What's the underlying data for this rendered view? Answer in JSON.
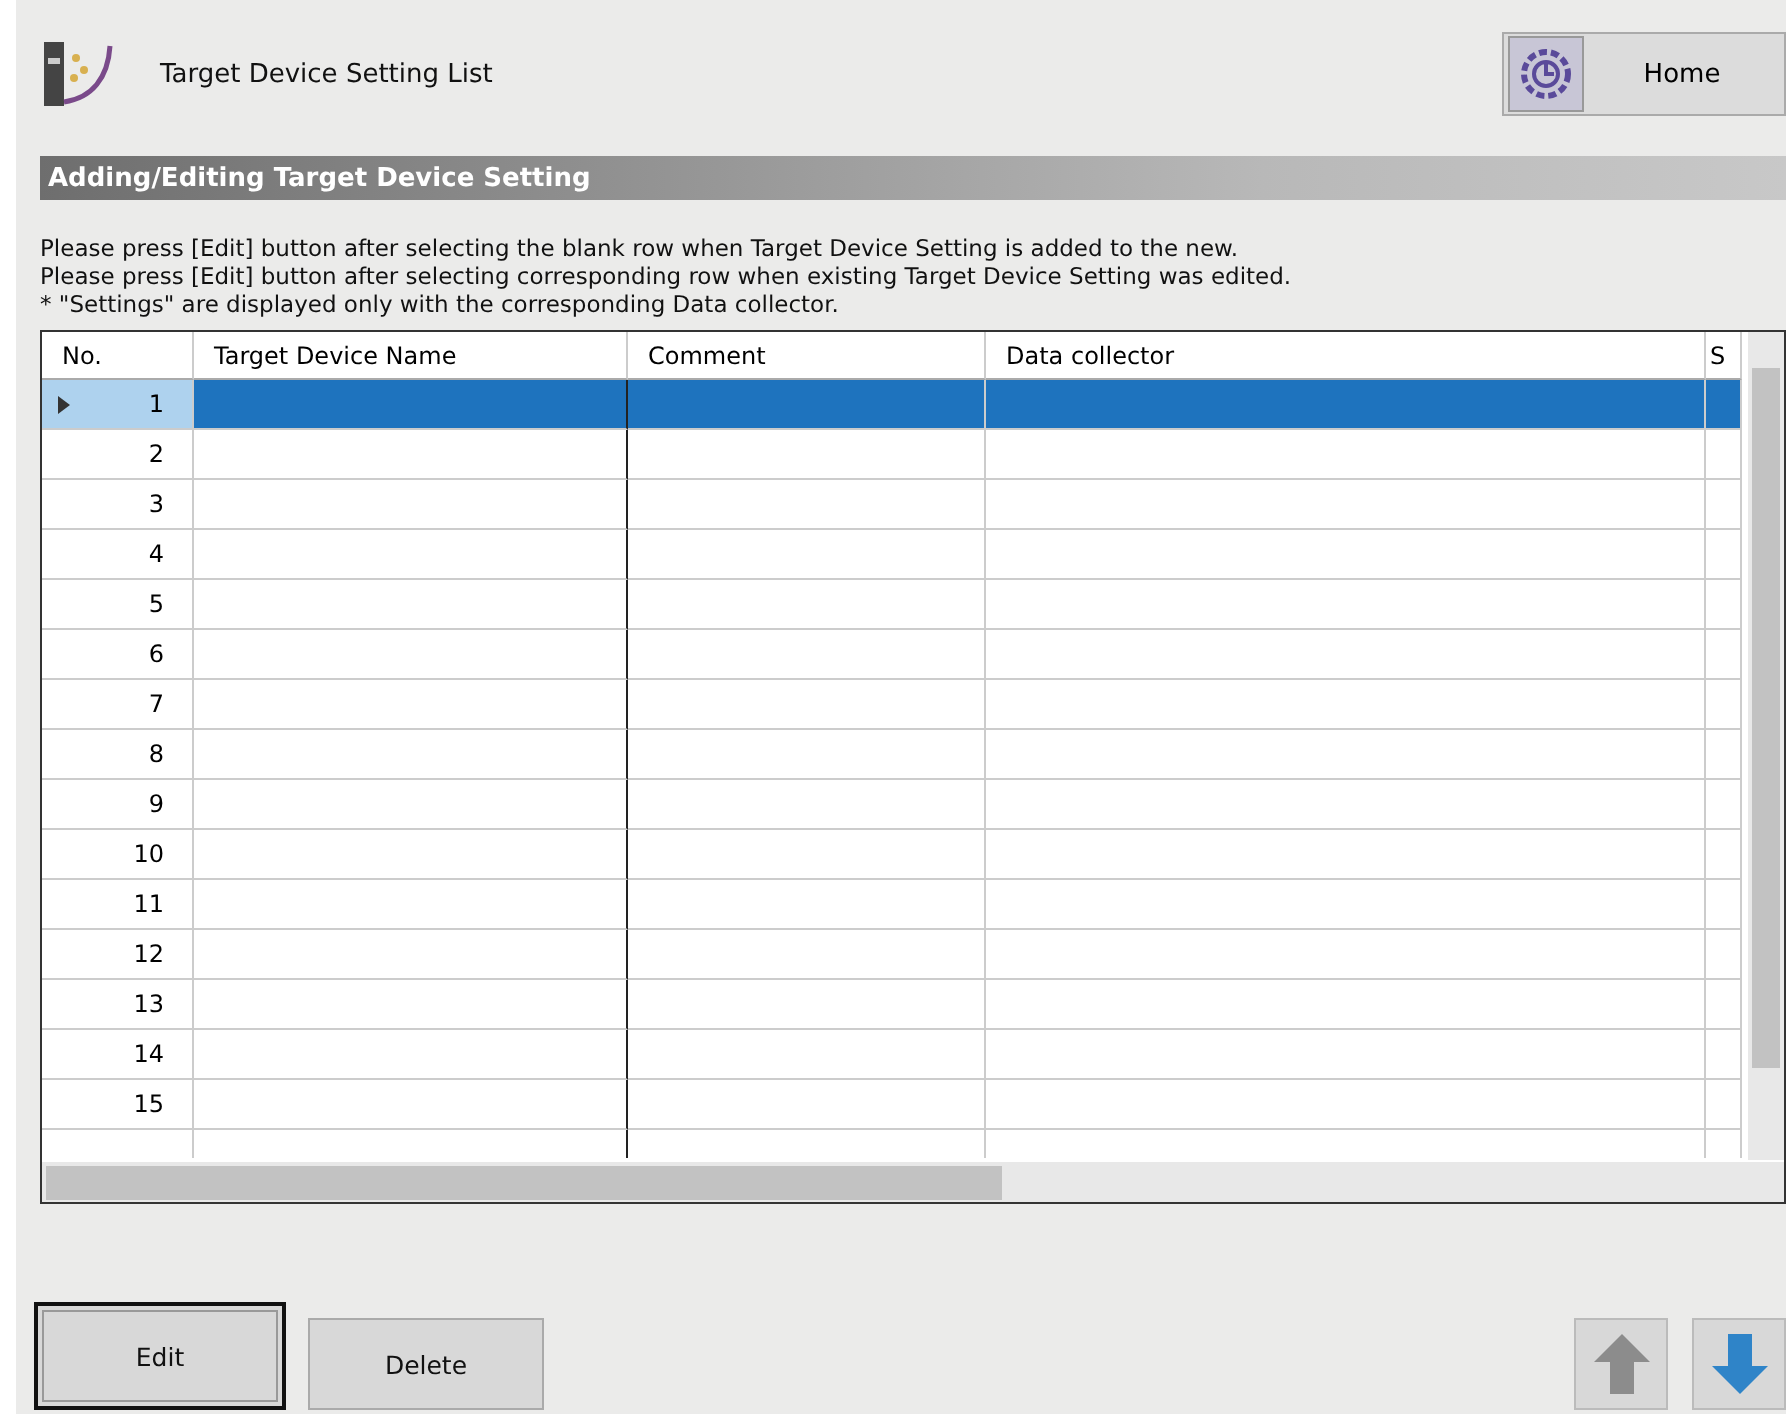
{
  "header": {
    "title": "Target Device Setting List",
    "home_button": "Home"
  },
  "section": {
    "title": "Adding/Editing Target Device Setting"
  },
  "instructions": [
    "Please press [Edit] button after selecting the blank row when Target Device Setting is added to the new.",
    "Please press [Edit] button after selecting corresponding row when existing Target Device Setting was edited.",
    "* \"Settings\" are displayed only with the corresponding Data collector."
  ],
  "table": {
    "columns": [
      "No.",
      "Target Device Name",
      "Comment",
      "Data collector",
      "S"
    ],
    "rows": [
      {
        "no": "1",
        "selected": true
      },
      {
        "no": "2",
        "selected": false
      },
      {
        "no": "3",
        "selected": false
      },
      {
        "no": "4",
        "selected": false
      },
      {
        "no": "5",
        "selected": false
      },
      {
        "no": "6",
        "selected": false
      },
      {
        "no": "7",
        "selected": false
      },
      {
        "no": "8",
        "selected": false
      },
      {
        "no": "9",
        "selected": false
      },
      {
        "no": "10",
        "selected": false
      },
      {
        "no": "11",
        "selected": false
      },
      {
        "no": "12",
        "selected": false
      },
      {
        "no": "13",
        "selected": false
      },
      {
        "no": "14",
        "selected": false
      },
      {
        "no": "15",
        "selected": false
      }
    ]
  },
  "buttons": [
    {
      "label": "Edit",
      "focused": true
    },
    {
      "label": "Delete",
      "focused": false
    }
  ],
  "move_buttons": [
    {
      "kind": "up",
      "disabled": true
    },
    {
      "kind": "down",
      "disabled": false
    }
  ]
}
